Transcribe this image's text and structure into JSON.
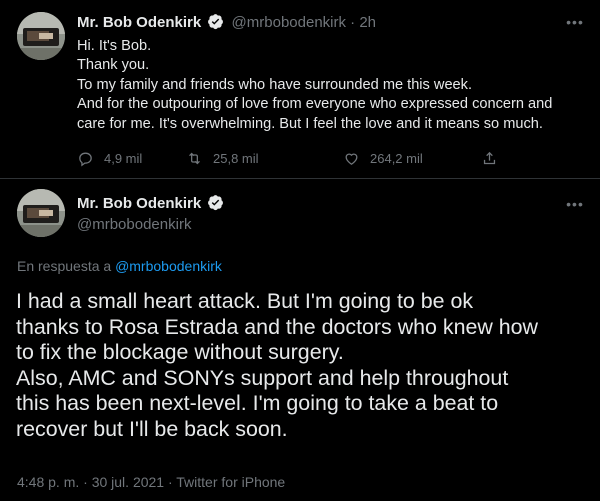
{
  "tweet1": {
    "author_name": "Mr. Bob Odenkirk",
    "handle": "@mrbobodenkirk",
    "separator": " · ",
    "time": "2h",
    "lines": [
      "Hi.  It's Bob.",
      "Thank you.",
      "To my family and friends who have surrounded me this week.",
      "And for the outpouring of love from everyone who expressed concern and",
      "care for me.  It's overwhelming.   But I feel the love and it means so much."
    ],
    "replies": "4,9 mil",
    "retweets": "25,8 mil",
    "likes": "264,2 mil"
  },
  "tweet2": {
    "author_name": "Mr. Bob Odenkirk",
    "handle": "@mrbobodenkirk",
    "reply_prefix": "En respuesta a ",
    "reply_handle": "@mrbobodenkirk",
    "lines": [
      "I had a small heart attack.   But I'm going to be ok",
      "thanks to Rosa Estrada and the doctors who knew how",
      "to fix the blockage without surgery.",
      "Also, AMC and SONYs support and help throughout",
      "this has been next-level.  I'm going to take a beat to",
      "recover but I'll be back soon."
    ],
    "timestamp": "4:48 p. m. · 30 jul. 2021 · ",
    "source": "Twitter for iPhone"
  },
  "icons": {
    "more": "more-dots-icon",
    "reply": "reply-icon",
    "retweet": "retweet-icon",
    "like": "heart-icon",
    "share": "share-icon",
    "verified": "verified-badge-icon"
  },
  "colors": {
    "background": "#000000",
    "text": "#e7e9ea",
    "secondary": "#71767b",
    "accent": "#1d9bf0",
    "divider": "#2f3336"
  }
}
